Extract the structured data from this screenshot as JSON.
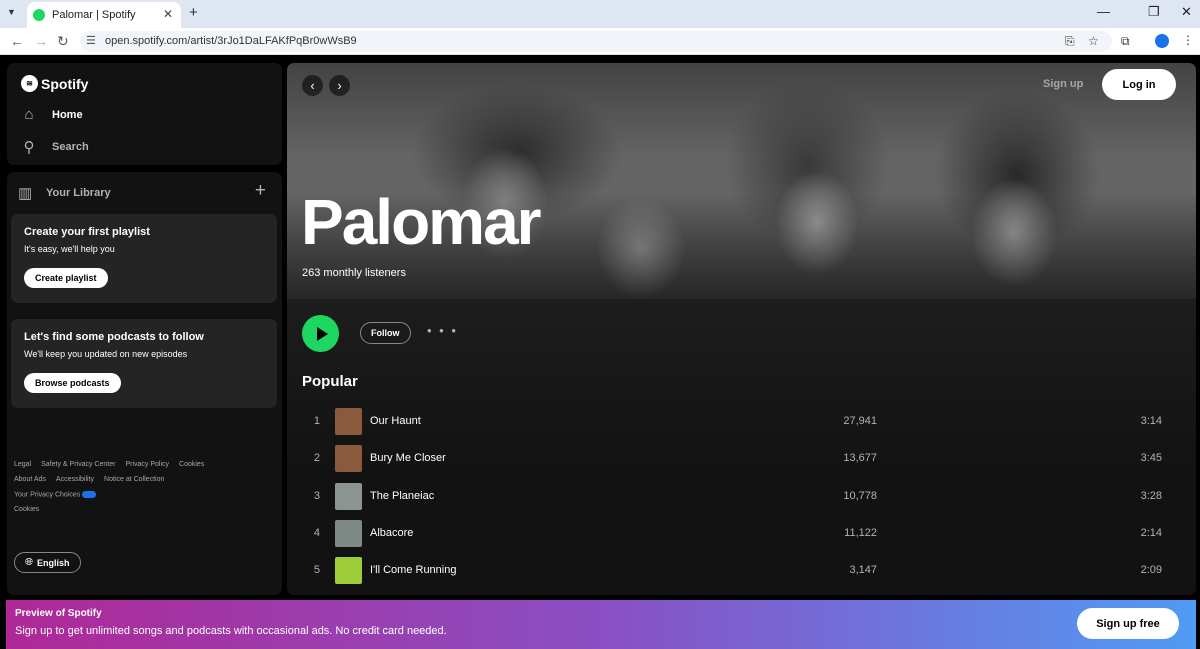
{
  "browser": {
    "tab_title": "Palomar | Spotify",
    "tab_close": "✕",
    "new_tab": "+",
    "url": "open.spotify.com/artist/3rJo1DaLFAKfPqBr0wWsB9",
    "window": {
      "minimize": "—",
      "restore": "❐",
      "close": "✕"
    }
  },
  "sidebar": {
    "logo_text": "Spotify",
    "home_label": "Home",
    "search_label": "Search",
    "library_label": "Your Library",
    "library_add": "+",
    "playlist_card": {
      "title": "Create your first playlist",
      "subtitle": "It's easy, we'll help you",
      "button": "Create playlist"
    },
    "podcast_card": {
      "title": "Let's find some podcasts to follow",
      "subtitle": "We'll keep you updated on new episodes",
      "button": "Browse podcasts"
    },
    "footer": {
      "row1": [
        "Legal",
        "Safety & Privacy Center",
        "Privacy Policy",
        "Cookies"
      ],
      "row2": [
        "About Ads",
        "Accessibility",
        "Notice at Collection"
      ],
      "privacy_choices": "Your Privacy Choices",
      "cookies": "Cookies"
    },
    "language_button": "English"
  },
  "header": {
    "signup_label": "Sign up",
    "login_label": "Log in"
  },
  "artist": {
    "name": "Palomar",
    "listeners": "263 monthly listeners"
  },
  "actions": {
    "follow_label": "Follow",
    "more_label": "• • •"
  },
  "popular": {
    "heading": "Popular",
    "tracks": [
      {
        "num": "1",
        "title": "Our Haunt",
        "plays": "27,941",
        "duration": "3:14",
        "art_color": "#8a5a3c"
      },
      {
        "num": "2",
        "title": "Bury Me Closer",
        "plays": "13,677",
        "duration": "3:45",
        "art_color": "#8a5a3c"
      },
      {
        "num": "3",
        "title": "The Planeiac",
        "plays": "10,778",
        "duration": "3:28",
        "art_color": "#8a9490"
      },
      {
        "num": "4",
        "title": "Albacore",
        "plays": "11,122",
        "duration": "2:14",
        "art_color": "#7f8a86"
      },
      {
        "num": "5",
        "title": "I'll Come Running",
        "plays": "3,147",
        "duration": "2:09",
        "art_color": "#9ccc3a"
      }
    ]
  },
  "banner": {
    "title": "Preview of Spotify",
    "subtitle": "Sign up to get unlimited songs and podcasts with occasional ads. No credit card needed.",
    "button": "Sign up free"
  },
  "colors": {
    "accent_green": "#1ed760",
    "background": "#121212"
  }
}
